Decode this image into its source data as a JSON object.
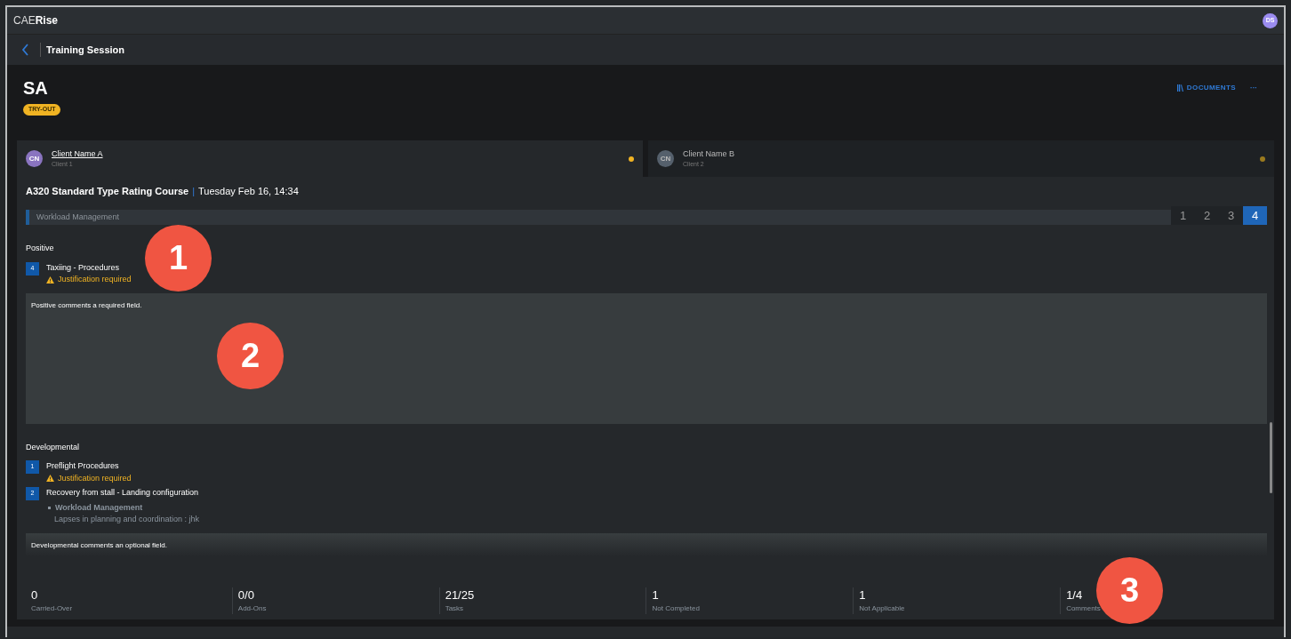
{
  "app": {
    "logo_light": "CAE",
    "logo_bold": "Rise",
    "user_initials": "DS"
  },
  "nav": {
    "title": "Training Session"
  },
  "header": {
    "title": "SA",
    "badge": "TRY-OUT",
    "documents": "DOCUMENTS",
    "more": "···"
  },
  "clients": [
    {
      "initials": "CN",
      "name": "Client Name A",
      "sub": "Client 1",
      "selected": true,
      "color": "#f0b323"
    },
    {
      "initials": "CN",
      "name": "Client Name B",
      "sub": "Client 2",
      "selected": false,
      "color": "#9a7a1e"
    }
  ],
  "course": {
    "name": "A320 Standard Type Rating Course",
    "separator": "|",
    "date": "Tuesday Feb 16, 14:34"
  },
  "faded_row": {
    "label": "Workload Management",
    "ratings": [
      {
        "label": "1",
        "selected": false
      },
      {
        "label": "2",
        "selected": false
      },
      {
        "label": "3",
        "selected": false
      },
      {
        "label": "4",
        "selected": true
      }
    ]
  },
  "sections": [
    {
      "title": "Positive",
      "items": [
        {
          "grade": "4",
          "name": "Taxiing - Procedures",
          "warning": "Justification required"
        }
      ],
      "comment": "Positive comments a required field.",
      "tall": true
    },
    {
      "title": "Developmental",
      "items": [
        {
          "grade": "1",
          "name": "Preflight Procedures",
          "warning": "Justification required"
        },
        {
          "grade": "2",
          "name": "Recovery from stall - Landing configuration",
          "sub_title": "Workload Management",
          "sub_text": "Lapses in planning and coordination : jhk"
        }
      ],
      "comment": "Developmental comments an optional field.",
      "tall": false
    }
  ],
  "stats": [
    {
      "value": "0",
      "label": "Carried-Over"
    },
    {
      "value": "0/0",
      "label": "Add-Ons"
    },
    {
      "value": "21/25",
      "label": "Tasks"
    },
    {
      "value": "1",
      "label": "Not Completed"
    },
    {
      "value": "1",
      "label": "Not Applicable"
    },
    {
      "value": "1/4",
      "label": "Comments"
    }
  ],
  "callouts": [
    "1",
    "2",
    "3"
  ]
}
